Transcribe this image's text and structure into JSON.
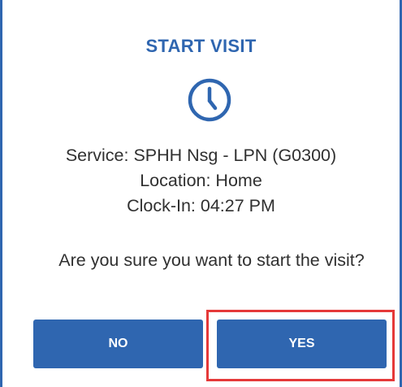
{
  "dialog": {
    "title": "START VISIT",
    "icon": "clock-icon",
    "service": "Service: SPHH Nsg - LPN (G0300)",
    "location": "Location: Home",
    "clock_in": "Clock-In: 04:27 PM",
    "question": "Are you sure you want to start the visit?",
    "no_label": "NO",
    "yes_label": "YES"
  },
  "colors": {
    "accent": "#2f66b0",
    "highlight": "#e53939",
    "text": "#303030"
  }
}
